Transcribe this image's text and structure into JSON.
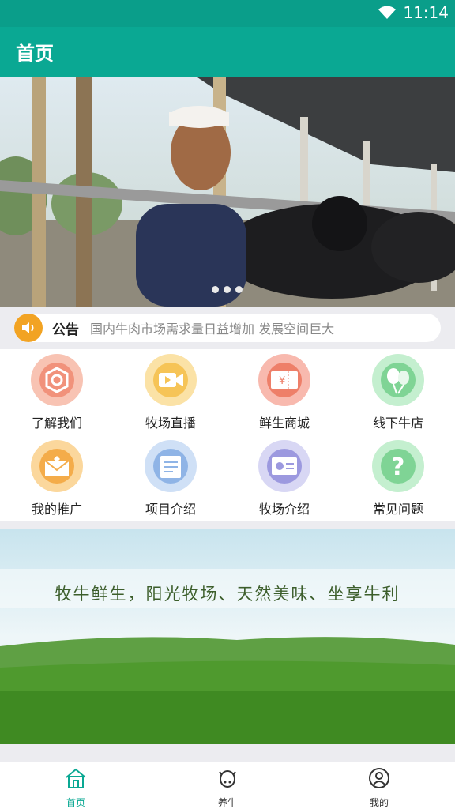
{
  "status_bar": {
    "time": "11:14"
  },
  "app_bar": {
    "title": "首页"
  },
  "notice": {
    "label": "公告",
    "text": "国内牛肉市场需求量日益增加 发展空间巨大"
  },
  "menu": [
    {
      "label": "了解我们",
      "icon": "about-us-icon",
      "color": "#f4a48e"
    },
    {
      "label": "牧场直播",
      "icon": "live-camera-icon",
      "color": "#f6c56a"
    },
    {
      "label": "鲜生商城",
      "icon": "mall-voucher-icon",
      "color": "#f08f7c"
    },
    {
      "label": "线下牛店",
      "icon": "balloon-icon",
      "color": "#8edca2"
    },
    {
      "label": "我的推广",
      "icon": "promotion-mail-icon",
      "color": "#f5b65e"
    },
    {
      "label": "项目介绍",
      "icon": "document-icon",
      "color": "#9ec0ea"
    },
    {
      "label": "牧场介绍",
      "icon": "presentation-board-icon",
      "color": "#a9a7e4"
    },
    {
      "label": "常见问题",
      "icon": "question-mark-icon",
      "color": "#8edca2"
    }
  ],
  "promo": {
    "slogan": "牧牛鲜生，阳光牧场、天然美味、坐享牛利"
  },
  "tabs": [
    {
      "label": "首页",
      "icon": "home-icon",
      "active": true
    },
    {
      "label": "养牛",
      "icon": "cow-face-icon",
      "active": false
    },
    {
      "label": "我的",
      "icon": "user-icon",
      "active": false
    }
  ],
  "colors": {
    "primary": "#0aa893",
    "notice_icon": "#f2a323"
  }
}
